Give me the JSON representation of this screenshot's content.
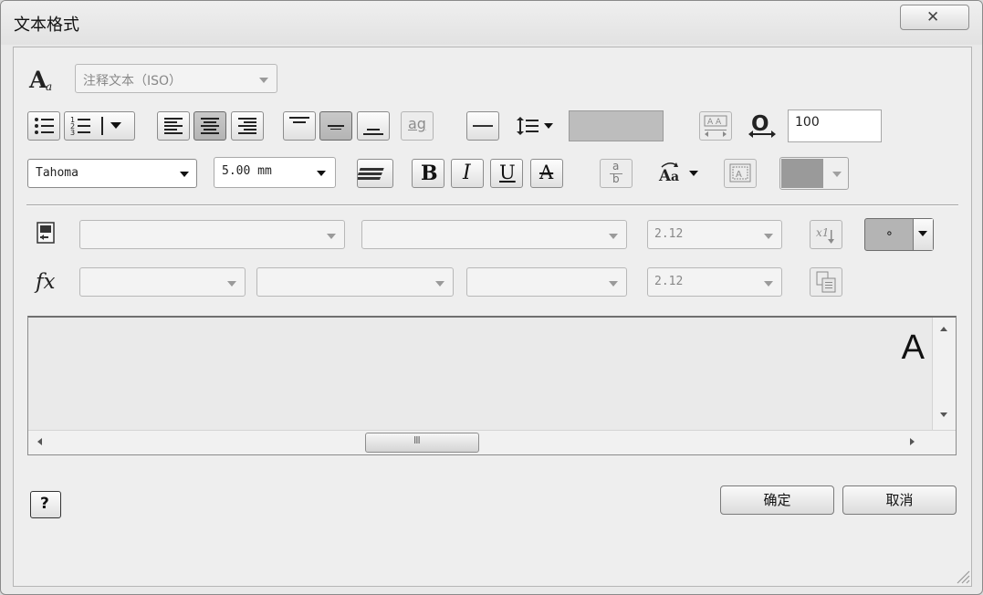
{
  "window": {
    "title": "文本格式"
  },
  "toolbar": {
    "style_select": "注释文本（ISO）",
    "width_value": "100",
    "font_select": "Tahoma",
    "size_select": "5.00 mm",
    "bold_label": "B",
    "italic_label": "I",
    "underline_label": "U",
    "strike_label": "A",
    "stack_label": "ag",
    "fraction_top": "a",
    "fraction_bottom": "b"
  },
  "parameters": {
    "row1_value": "2.12",
    "row1_symbol": "∘",
    "row2_value": "2.12",
    "fx_label": "fx"
  },
  "editor": {
    "text": "A",
    "scroll_thumb": "III"
  },
  "footer": {
    "help_label": "?",
    "ok_label": "确定",
    "cancel_label": "取消"
  }
}
